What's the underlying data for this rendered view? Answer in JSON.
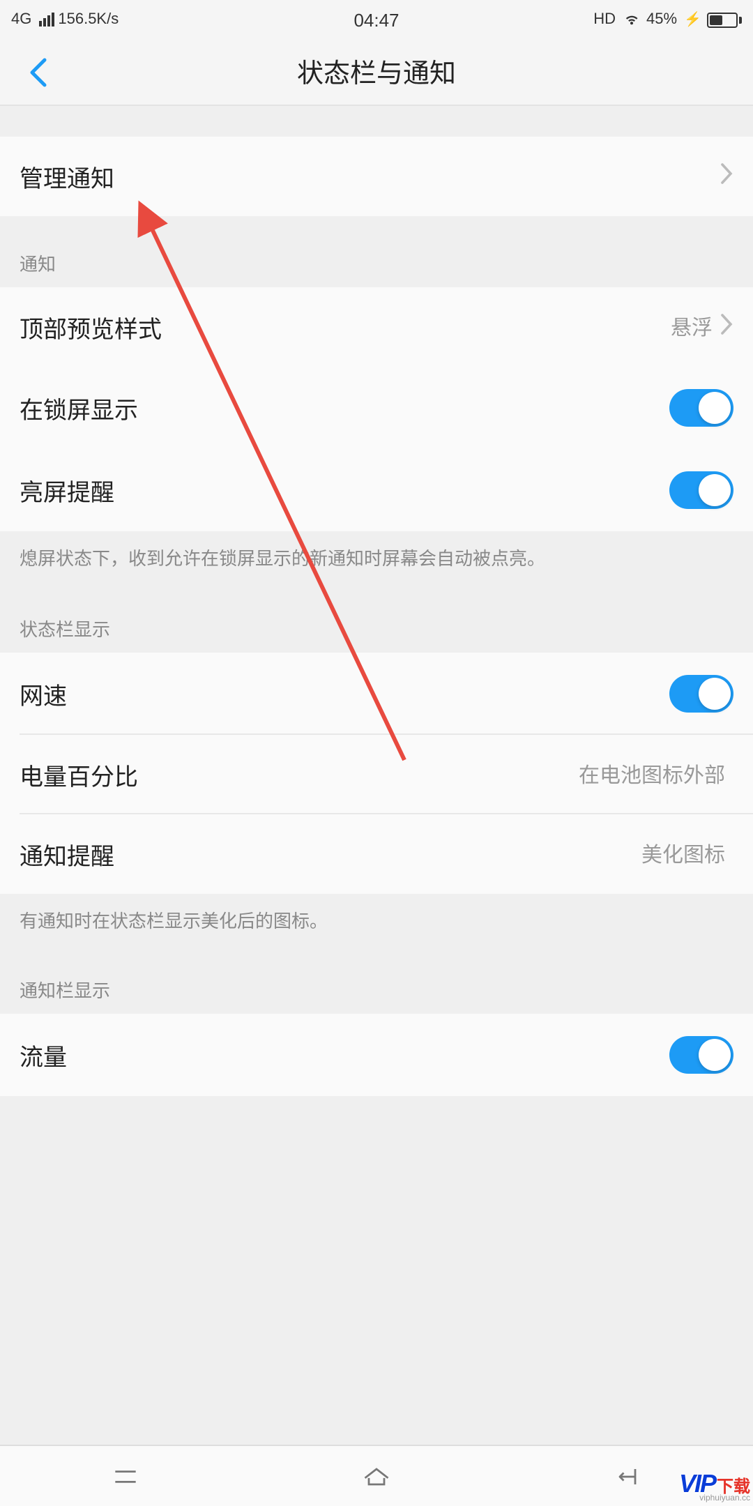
{
  "statusBar": {
    "network": "4G",
    "speed": "156.5K/s",
    "time": "04:47",
    "hd": "HD",
    "battery": "45%"
  },
  "header": {
    "title": "状态栏与通知"
  },
  "sections": {
    "manage": {
      "label": "管理通知"
    },
    "notification": {
      "header": "通知",
      "previewStyle": {
        "label": "顶部预览样式",
        "value": "悬浮"
      },
      "lockscreen": {
        "label": "在锁屏显示"
      },
      "wakeScreen": {
        "label": "亮屏提醒"
      },
      "footer": "熄屏状态下，收到允许在锁屏显示的新通知时屏幕会自动被点亮。"
    },
    "statusDisplay": {
      "header": "状态栏显示",
      "netSpeed": {
        "label": "网速"
      },
      "batteryPct": {
        "label": "电量百分比",
        "value": "在电池图标外部"
      },
      "notifyRemind": {
        "label": "通知提醒",
        "value": "美化图标"
      },
      "footer": "有通知时在状态栏显示美化后的图标。"
    },
    "notificationBar": {
      "header": "通知栏显示",
      "traffic": {
        "label": "流量"
      }
    }
  },
  "watermark": {
    "brand": "VIP",
    "suffix": "下载",
    "sub": "viphuiyuan.cc"
  }
}
